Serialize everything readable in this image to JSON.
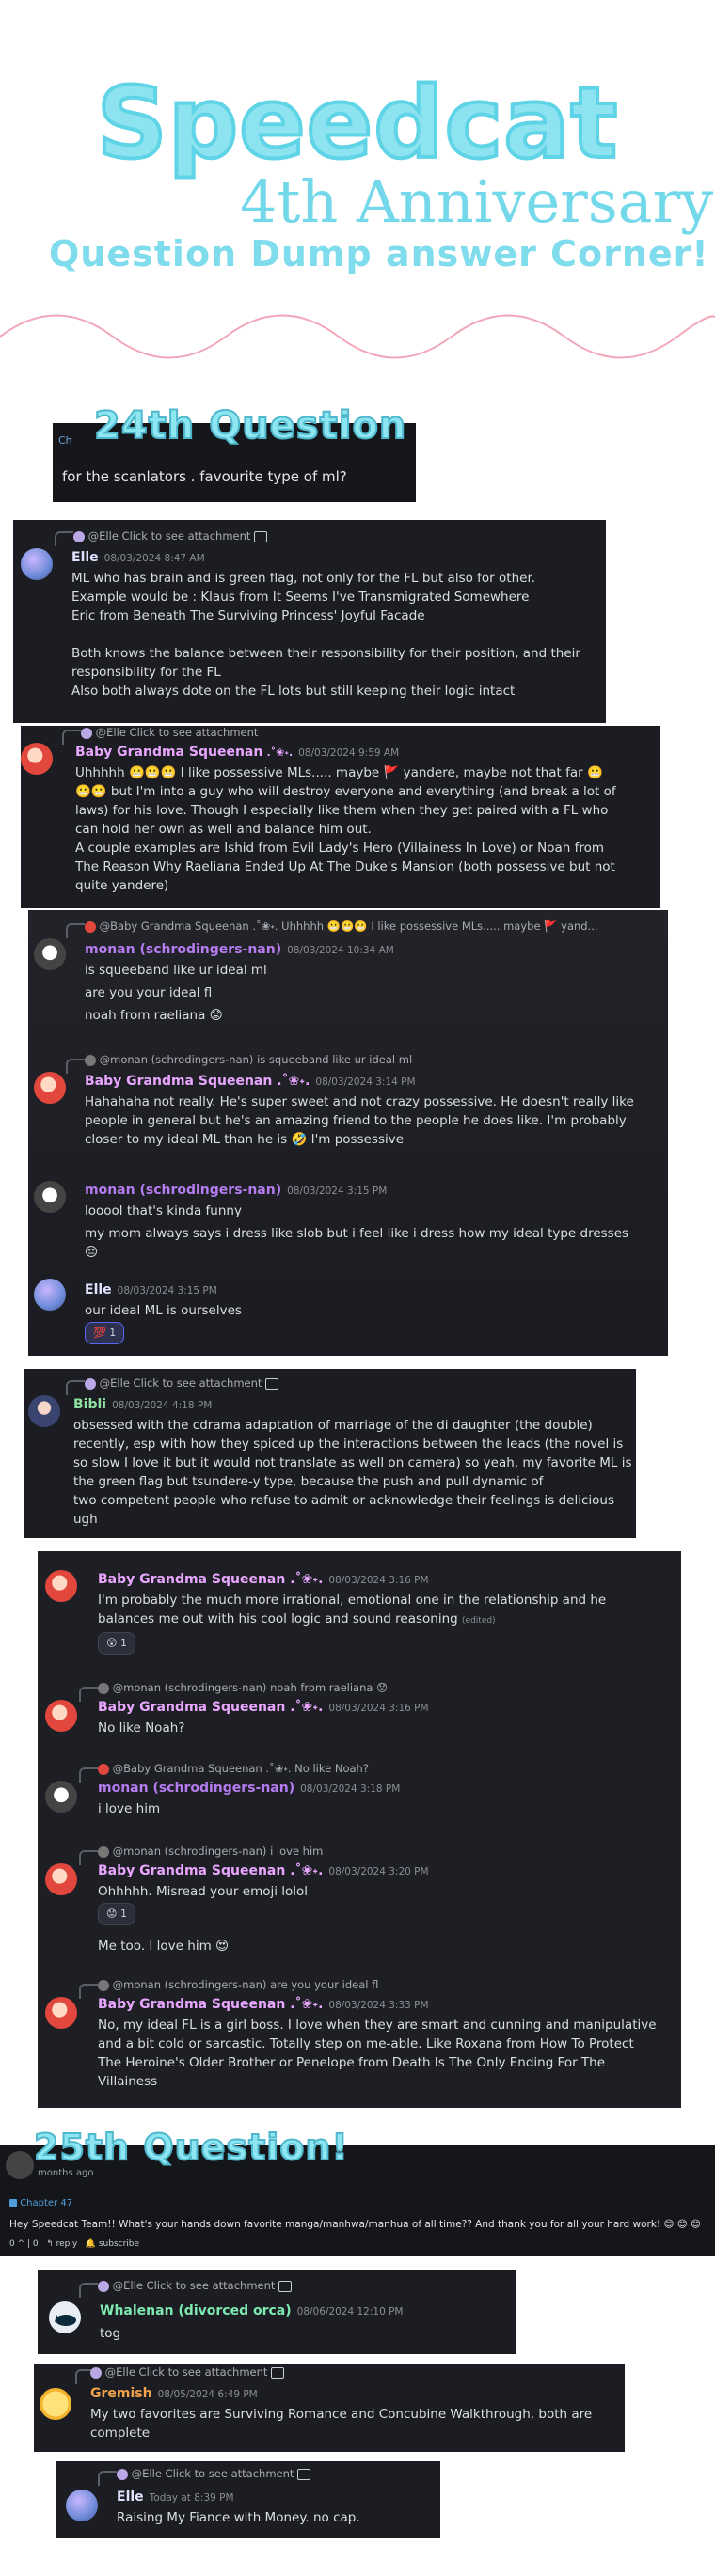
{
  "header": {
    "title": "Speedcat",
    "subtitle": "4th Anniversary",
    "tagline": "Question Dump answer Corner!"
  },
  "q24": {
    "heading": "24th Question",
    "question": "for the scanlators . favourite type of ml?",
    "channel_tag": "Ch"
  },
  "chat1": {
    "reply": "@Elle Click to see attachment",
    "name": "Elle",
    "time": "08/03/2024 8:47 AM",
    "lines": [
      "ML who has brain and is green flag, not only for the FL but also for other.",
      "Example would be : Klaus from It Seems I've Transmigrated Somewhere",
      "Eric from Beneath The Surviving Princess' Joyful Facade",
      "",
      "Both knows the balance between their responsibility for their position, and their",
      "responsibility for the FL",
      "Also both always dote on the FL lots but still keeping their logic intact"
    ]
  },
  "chat2": {
    "reply": "@Elle Click to see attachment",
    "name": "Baby Grandma Squeenan",
    "decor": ".˚❀˖.",
    "time": "08/03/2024 9:59 AM",
    "lines": [
      "Uhhhhh 😬😬😬 I like possessive MLs..... maybe 🚩 yandere, maybe not that far 😬",
      "😬😬 but I'm into a guy who will destroy everyone and everything (and break a lot of",
      "laws) for his love. Though I especially like them when they get paired with a FL who",
      "can hold her own as well and balance him out.",
      "A couple examples are Ishid from Evil Lady's Hero (Villainess In Love) or Noah from",
      "The Reason Why Raeliana Ended Up At The Duke's Mansion (both possessive but not",
      "quite yandere)"
    ]
  },
  "chat3": {
    "reply1": "@Baby Grandma Squeenan .˚❀˖. Uhhhhh 😬😬😬 I like possessive MLs..... maybe 🚩 yand...",
    "m1_name": "monan (schrodingers-nan)",
    "m1_time": "08/03/2024 10:34 AM",
    "m1_l1": "is squeeband like ur ideal ml",
    "m1_l2": "are you your ideal fl",
    "m1_l3": "noah from raeliana 😟",
    "reply2": "@monan (schrodingers-nan) is squeeband like ur ideal ml",
    "m2_name": "Baby Grandma Squeenan .˚❀˖.",
    "m2_time": "08/03/2024 3:14 PM",
    "m2_l1": "Hahahaha not really. He's super sweet and not crazy possessive. He doesn't really like",
    "m2_l2": "people in general but he's an amazing friend to the people he does like. I'm probably",
    "m2_l3": "closer to my ideal ML than he is 🤣 I'm possessive",
    "m3_name": "monan (schrodingers-nan)",
    "m3_time": "08/03/2024 3:15 PM",
    "m3_l1": "looool that's kinda funny",
    "m3_l2": "my mom always says i dress like slob but i feel like i dress how my ideal type dresses",
    "m3_l3": "😔",
    "m4_name": "Elle",
    "m4_time": "08/03/2024 3:15 PM",
    "m4_l1": "our ideal ML is ourselves",
    "m4_reaction": "💯 1"
  },
  "chat4": {
    "reply": "@Elle Click to see attachment",
    "name": "Bibli",
    "time": "08/03/2024 4:18 PM",
    "lines": [
      "obsessed with the cdrama adaptation of marriage of the di daughter (the double)",
      "recently, esp with how they spiced up the interactions between the leads (the novel is",
      "so slow I love it but it would not translate as well on camera) so yeah, my favorite ML is",
      "the green flag but tsundere-y type, because the push and pull dynamic of",
      "two competent people who refuse to admit or acknowledge their feelings is delicious",
      "ugh"
    ]
  },
  "chat5": {
    "m1_name": "Baby Grandma Squeenan .˚❀˖.",
    "m1_time": "08/03/2024 3:16 PM",
    "m1_l1": "I'm probably the much more irrational, emotional one in the relationship and he",
    "m1_l2": "balances me out with his cool logic and sound reasoning",
    "m1_edited": "(edited)",
    "m1_reaction": "😲 1",
    "r2": "@monan (schrodingers-nan) noah from raeliana 😟",
    "m2_name": "Baby Grandma Squeenan .˚❀˖.",
    "m2_time": "08/03/2024 3:16 PM",
    "m2_l1": "No like Noah?",
    "r3": "@Baby Grandma Squeenan .˚❀˖. No like Noah?",
    "m3_name": "monan (schrodingers-nan)",
    "m3_time": "08/03/2024 3:18 PM",
    "m3_l1": "i love him",
    "r4": "@monan (schrodingers-nan) i love him",
    "m4_name": "Baby Grandma Squeenan .˚❀˖.",
    "m4_time": "08/03/2024 3:20 PM",
    "m4_l1": "Ohhhhh. Misread your emoji lolol",
    "m4_reaction": "😟 1",
    "m4_l2": "Me too. I love him 😍",
    "r5": "@monan (schrodingers-nan) are you your ideal fl",
    "m5_name": "Baby Grandma Squeenan .˚❀˖.",
    "m5_time": "08/03/2024 3:33 PM",
    "m5_l1": "No, my ideal FL is a girl boss. I love when they are smart and cunning and manipulative",
    "m5_l2": "and a bit cold or sarcastic. Totally step on me-able. Like Roxana from How To Protect",
    "m5_l3": "The Heroine's Older Brother or Penelope from Death Is The Only Ending For The",
    "m5_l4": "Villainess"
  },
  "q25": {
    "heading": "25th Question!",
    "meta": "months ago",
    "chapter": "Chapter 47",
    "question": "Hey Speedcat Team!! What's your hands down favorite manga/manhwa/manhua of all time?? And thank you for all your hard work! 😊 😊 😊",
    "likes": "0",
    "dislikes": "0",
    "reply_label": "reply",
    "subscribe_label": "subscribe"
  },
  "chat6": {
    "reply": "@Elle Click to see attachment",
    "name": "Whalenan (divorced orca)",
    "time": "08/06/2024 12:10 PM",
    "text": "tog"
  },
  "chat7": {
    "reply": "@Elle Click to see attachment",
    "name": "Gremish",
    "time": "08/05/2024 6:49 PM",
    "l1": "My two favorites are Surviving Romance and Concubine Walkthrough, both are",
    "l2": "complete"
  },
  "chat8": {
    "reply": "@Elle Click to see attachment",
    "name": "Elle",
    "time": "Today at 8:39 PM",
    "text": "Raising My Fiance with Money. no cap."
  },
  "colors": {
    "accent": "#7fdcec",
    "elle": "#dfe3ff",
    "baby": "#e9a6ff",
    "monan": "#b47cf0",
    "bibli": "#8fe0a0",
    "whale": "#7de8b0",
    "grem": "#f0a24c"
  }
}
